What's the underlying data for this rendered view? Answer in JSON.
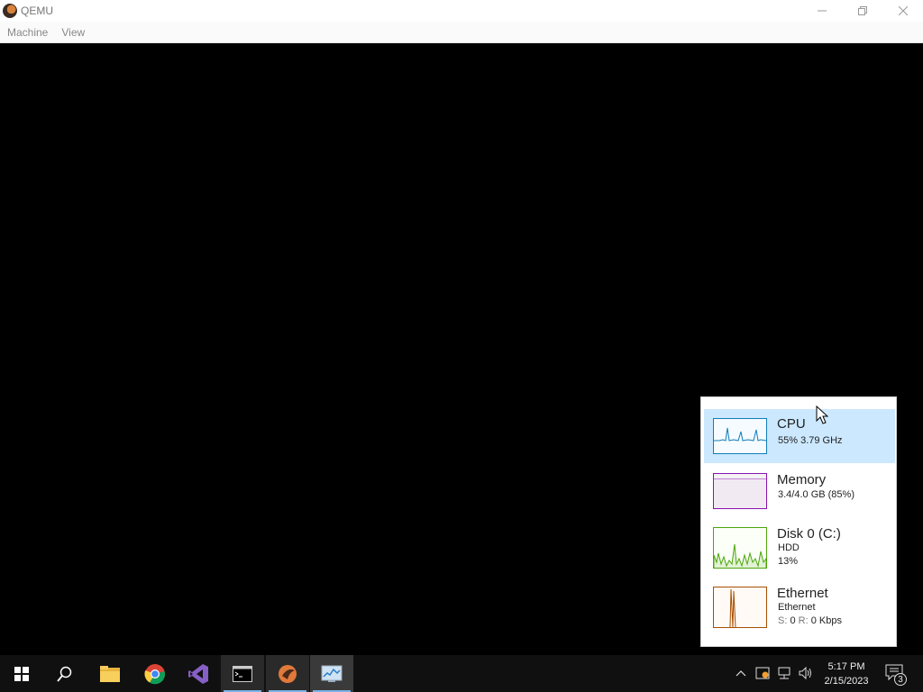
{
  "window": {
    "title": "QEMU",
    "controls": {
      "minimize": "—",
      "restore": "❐",
      "close": "✕"
    }
  },
  "menu": [
    "Machine",
    "View"
  ],
  "perf": {
    "cpu": {
      "title": "CPU",
      "subtitle": "55% 3.79 GHz",
      "color": "#117dbb"
    },
    "memory": {
      "title": "Memory",
      "subtitle": "3.4/4.0 GB (85%)",
      "color": "#8b12ae"
    },
    "disk": {
      "title": "Disk 0 (C:)",
      "line1": "HDD",
      "line2": "13%",
      "color": "#4da60c"
    },
    "ethernet": {
      "title": "Ethernet",
      "line1": "Ethernet",
      "line2_prefix_s": "S:",
      "line2_s_val": "0",
      "line2_prefix_r": "R:",
      "line2_r_val": "0 Kbps",
      "color": "#a74f01"
    }
  },
  "taskbar": {
    "clock_time": "5:17 PM",
    "clock_date": "2/15/2023",
    "notification_count": "3",
    "icons": [
      "windows-start-icon",
      "search-icon",
      "file-explorer-icon",
      "chrome-icon",
      "visual-studio-icon",
      "command-prompt-icon",
      "qemu-icon",
      "task-manager-icon"
    ]
  }
}
